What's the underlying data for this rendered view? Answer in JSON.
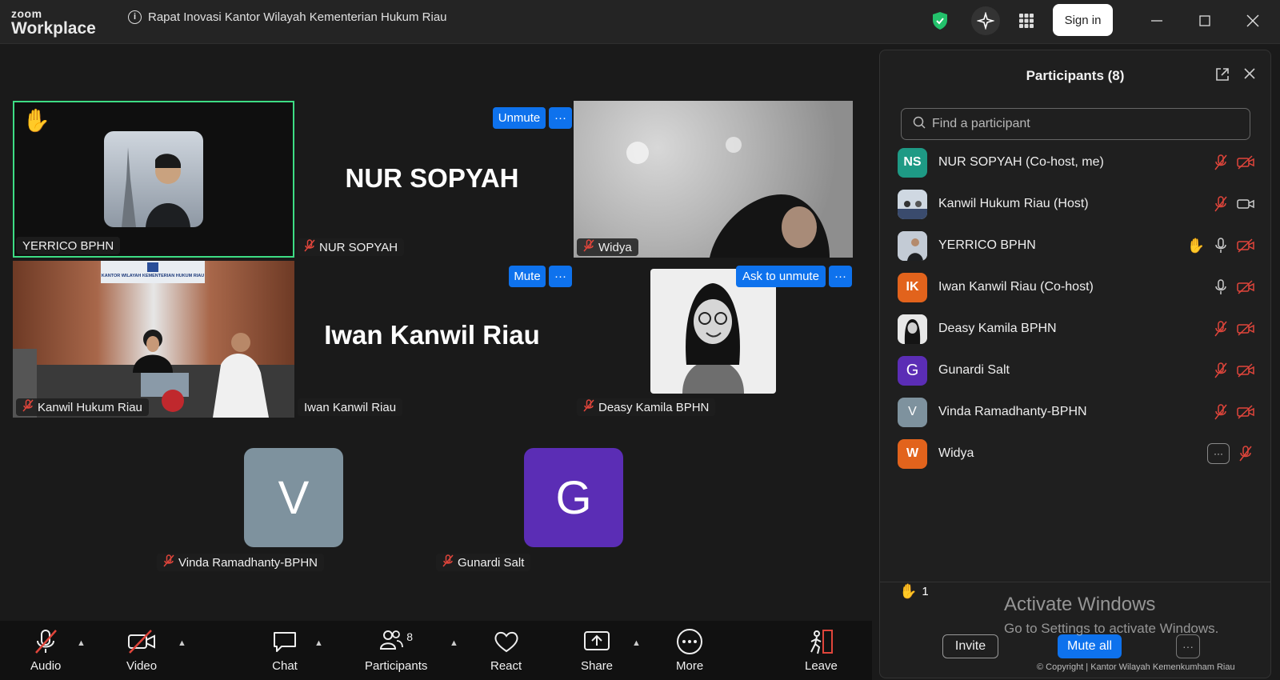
{
  "app": {
    "logo_line1": "zoom",
    "logo_line2": "Workplace",
    "meeting_title": "Rapat Inovasi Kantor Wilayah Kementerian Hukum Riau",
    "sign_in": "Sign in"
  },
  "tiles": {
    "yerrico": {
      "name": "YERRICO BPHN"
    },
    "nur": {
      "big_name": "NUR SOPYAH",
      "name": "NUR SOPYAH",
      "unmute_label": "Unmute"
    },
    "widya": {
      "name": "Widya"
    },
    "kanwil": {
      "name": "Kanwil Hukum Riau",
      "banner": "KANTOR WILAYAH KEMENTERIAN HUKUM RIAU"
    },
    "iwan": {
      "big_name": "Iwan Kanwil Riau",
      "name": "Iwan Kanwil Riau",
      "mute_label": "Mute"
    },
    "deasy": {
      "name": "Deasy Kamila BPHN",
      "ask_label": "Ask to unmute"
    },
    "vinda": {
      "initial": "V",
      "name": "Vinda Ramadhanty-BPHN"
    },
    "gunardi": {
      "initial": "G",
      "name": "Gunardi Salt"
    }
  },
  "toolbar": {
    "audio": "Audio",
    "video": "Video",
    "chat": "Chat",
    "participants": "Participants",
    "participants_count": "8",
    "react": "React",
    "share": "Share",
    "more": "More",
    "leave": "Leave"
  },
  "panel": {
    "title": "Participants (8)",
    "search_placeholder": "Find a participant",
    "participants": [
      {
        "initials": "NS",
        "name": "NUR SOPYAH (Co-host, me)",
        "color": "#1e9a85"
      },
      {
        "initials": "",
        "name": "Kanwil Hukum Riau (Host)",
        "color": "#5a6f88"
      },
      {
        "initials": "",
        "name": "YERRICO BPHN",
        "color": "#8a95a5"
      },
      {
        "initials": "IK",
        "name": "Iwan Kanwil Riau (Co-host)",
        "color": "#e2631c"
      },
      {
        "initials": "",
        "name": "Deasy Kamila BPHN",
        "color": "#cfcfcf"
      },
      {
        "initials": "G",
        "name": "Gunardi Salt",
        "color": "#5b2db5"
      },
      {
        "initials": "V",
        "name": "Vinda Ramadhanty-BPHN",
        "color": "#7e929e"
      },
      {
        "initials": "W",
        "name": "Widya",
        "color": "#e2631c"
      }
    ],
    "raised_hands": "1",
    "invite": "Invite",
    "mute_all": "Mute all",
    "more_button": "···"
  },
  "overlay": {
    "activate_title": "Activate Windows",
    "activate_sub": "Go to Settings to activate Windows.",
    "copyright": "© Copyright | Kantor Wilayah Kemenkumham Riau"
  },
  "colors": {
    "accent": "#0e72ed",
    "active_speaker": "#3ddc84",
    "muted_red": "#e0453b"
  }
}
